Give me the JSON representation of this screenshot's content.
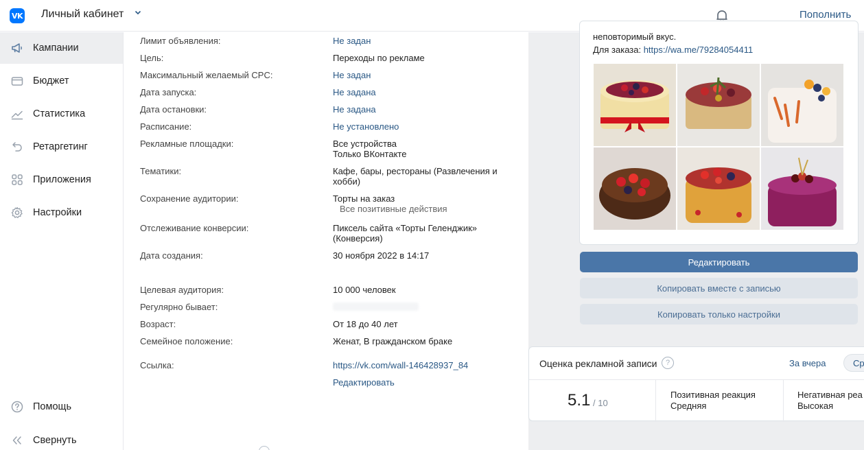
{
  "header": {
    "logo": "VK",
    "title": "Личный кабинет",
    "topup": "Пополнить"
  },
  "sidebar": {
    "items": [
      {
        "label": "Кампании",
        "icon": "megaphone-icon",
        "active": true
      },
      {
        "label": "Бюджет",
        "icon": "wallet-icon"
      },
      {
        "label": "Статистика",
        "icon": "chart-icon"
      },
      {
        "label": "Ретаргетинг",
        "icon": "retarget-icon"
      },
      {
        "label": "Приложения",
        "icon": "apps-icon"
      },
      {
        "label": "Настройки",
        "icon": "gear-icon"
      }
    ],
    "bottom": [
      {
        "label": "Помощь",
        "icon": "help-icon"
      },
      {
        "label": "Свернуть",
        "icon": "collapse-icon"
      }
    ]
  },
  "details": {
    "limit_label": "Лимит объявления:",
    "limit_value": "Не задан",
    "goal_label": "Цель:",
    "goal_value": "Переходы по рекламе",
    "cpc_label": "Максимальный желаемый CPC:",
    "cpc_value": "Не задан",
    "start_label": "Дата запуска:",
    "start_value": "Не задана",
    "stop_label": "Дата остановки:",
    "stop_value": "Не задана",
    "schedule_label": "Расписание:",
    "schedule_value": "Не установлено",
    "platforms_label": "Рекламные площадки:",
    "platforms_line1": "Все устройства",
    "platforms_line2": "Только ВКонтакте",
    "topics_label": "Тематики:",
    "topics_line1": "Кафе, бары, рестораны (Развлечения и",
    "topics_line2": "хобби)",
    "audience_save_label": "Сохранение аудитории:",
    "audience_save_line1": "Торты на заказ",
    "audience_save_line2": "Все позитивные действия",
    "conversion_label": "Отслеживание конверсии:",
    "conversion_line1": "Пиксель сайта «Торты Геленджик»",
    "conversion_line2": "(Конверсия)",
    "created_label": "Дата создания:",
    "created_value": "30 ноября 2022 в 14:17",
    "target_label": "Целевая аудитория:",
    "target_value": "10 000 человек",
    "regular_label": "Регулярно бывает:",
    "age_label": "Возраст:",
    "age_value": "От 18 до 40 лет",
    "family_label": "Семейное положение:",
    "family_value": "Женат, В гражданском браке",
    "link_label": "Ссылка:",
    "link_value": "https://vk.com/wall-146428937_84",
    "edit_link": "Редактировать"
  },
  "post": {
    "text_line1": "неповторимый вкус.",
    "order_prefix": "Для заказа: ",
    "order_link": "https://wa.me/79284054411"
  },
  "buttons": {
    "edit": "Редактировать",
    "copy_with_post": "Копировать вместе с записью",
    "copy_settings": "Копировать только настройки"
  },
  "rating": {
    "title": "Оценка рекламной записи",
    "period": "За вчера",
    "period2": "Ср",
    "score": "5.1",
    "score_max": "/ 10",
    "positive_label": "Позитивная реакция",
    "positive_value": "Средняя",
    "negative_label": "Негативная реа",
    "negative_value": "Высокая"
  },
  "colors": {
    "accent": "#4a76a8",
    "link": "#2a5885",
    "vk_blue": "#0077ff",
    "panel_bg": "#edeef0"
  }
}
